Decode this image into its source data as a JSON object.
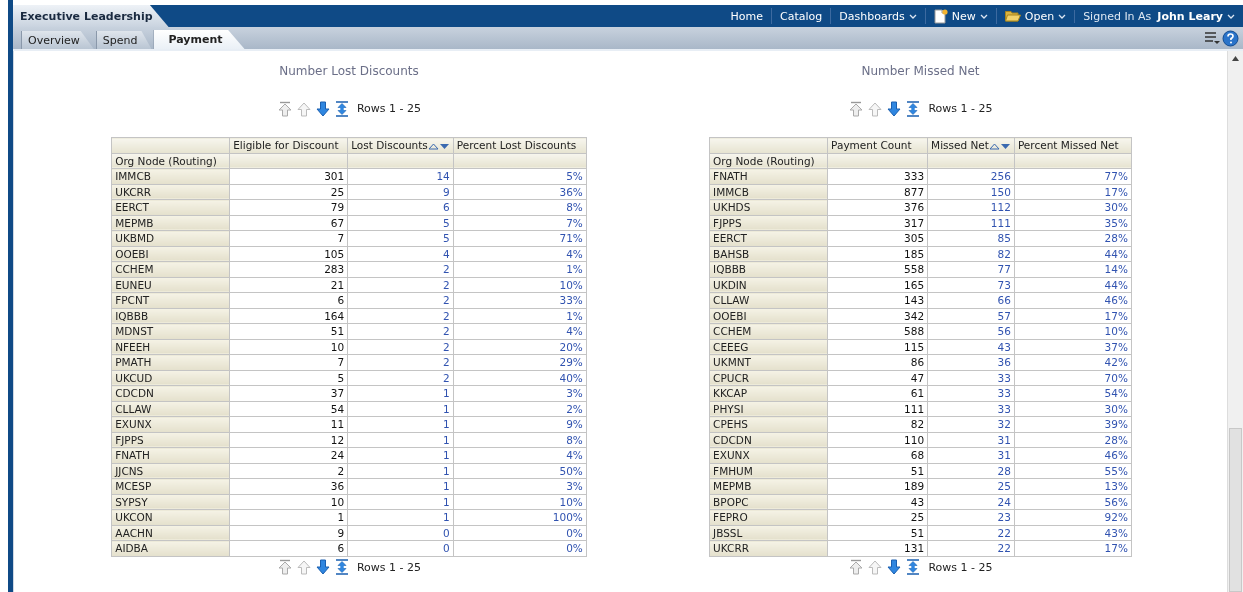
{
  "header": {
    "app_title": "Executive Leadership",
    "menu": [
      {
        "label": "Home",
        "kind": "link"
      },
      {
        "label": "Catalog",
        "kind": "link"
      },
      {
        "label": "Dashboards",
        "kind": "dropdown"
      },
      {
        "label": "New",
        "kind": "new"
      },
      {
        "label": "Open",
        "kind": "open"
      }
    ],
    "signed_in_label": "Signed In As",
    "user": "John Leary"
  },
  "tabs": [
    {
      "label": "Overview",
      "selected": false
    },
    {
      "label": "Spend",
      "selected": false
    },
    {
      "label": "Payment",
      "selected": true
    }
  ],
  "panels": [
    {
      "title": "Number Lost Discounts",
      "pager_top": "Rows 1 - 25",
      "pager_bottom": "Rows 1 - 25",
      "table": {
        "row_header": "Org Node (Routing)",
        "columns": [
          {
            "kind": "label"
          },
          {
            "kind": "number",
            "label": "Eligible for Discount",
            "sorted": false
          },
          {
            "kind": "link",
            "label": "Lost Discounts",
            "sorted": true
          },
          {
            "kind": "link",
            "label": "Percent Lost Discounts",
            "sorted": false
          }
        ],
        "rows": [
          [
            "IMMCB",
            "301",
            "14",
            "5%"
          ],
          [
            "UKCRR",
            "25",
            "9",
            "36%"
          ],
          [
            "EERCT",
            "79",
            "6",
            "8%"
          ],
          [
            "MEPMB",
            "67",
            "5",
            "7%"
          ],
          [
            "UKBMD",
            "7",
            "5",
            "71%"
          ],
          [
            "OOEBI",
            "105",
            "4",
            "4%"
          ],
          [
            "CCHEM",
            "283",
            "2",
            "1%"
          ],
          [
            "EUNEU",
            "21",
            "2",
            "10%"
          ],
          [
            "FPCNT",
            "6",
            "2",
            "33%"
          ],
          [
            "IQBBB",
            "164",
            "2",
            "1%"
          ],
          [
            "MDNST",
            "51",
            "2",
            "4%"
          ],
          [
            "NFEEH",
            "10",
            "2",
            "20%"
          ],
          [
            "PMATH",
            "7",
            "2",
            "29%"
          ],
          [
            "UKCUD",
            "5",
            "2",
            "40%"
          ],
          [
            "CDCDN",
            "37",
            "1",
            "3%"
          ],
          [
            "CLLAW",
            "54",
            "1",
            "2%"
          ],
          [
            "EXUNX",
            "11",
            "1",
            "9%"
          ],
          [
            "FJPPS",
            "12",
            "1",
            "8%"
          ],
          [
            "FNATH",
            "24",
            "1",
            "4%"
          ],
          [
            "JJCNS",
            "2",
            "1",
            "50%"
          ],
          [
            "MCESP",
            "36",
            "1",
            "3%"
          ],
          [
            "SYPSY",
            "10",
            "1",
            "10%"
          ],
          [
            "UKCON",
            "1",
            "1",
            "100%"
          ],
          [
            "AACHN",
            "9",
            "0",
            "0%"
          ],
          [
            "AIDBA",
            "6",
            "0",
            "0%"
          ]
        ]
      }
    },
    {
      "title": "Number Missed Net",
      "pager_top": "Rows 1 - 25",
      "pager_bottom": "Rows 1 - 25",
      "table": {
        "row_header": "Org Node (Routing)",
        "columns": [
          {
            "kind": "label"
          },
          {
            "kind": "number",
            "label": "Payment Count",
            "sorted": false
          },
          {
            "kind": "link",
            "label": "Missed Net",
            "sorted": true
          },
          {
            "kind": "link",
            "label": "Percent Missed Net",
            "sorted": false
          }
        ],
        "rows": [
          [
            "FNATH",
            "333",
            "256",
            "77%"
          ],
          [
            "IMMCB",
            "877",
            "150",
            "17%"
          ],
          [
            "UKHDS",
            "376",
            "112",
            "30%"
          ],
          [
            "FJPPS",
            "317",
            "111",
            "35%"
          ],
          [
            "EERCT",
            "305",
            "85",
            "28%"
          ],
          [
            "BAHSB",
            "185",
            "82",
            "44%"
          ],
          [
            "IQBBB",
            "558",
            "77",
            "14%"
          ],
          [
            "UKDIN",
            "165",
            "73",
            "44%"
          ],
          [
            "CLLAW",
            "143",
            "66",
            "46%"
          ],
          [
            "OOEBI",
            "342",
            "57",
            "17%"
          ],
          [
            "CCHEM",
            "588",
            "56",
            "10%"
          ],
          [
            "CEEEG",
            "115",
            "43",
            "37%"
          ],
          [
            "UKMNT",
            "86",
            "36",
            "42%"
          ],
          [
            "CPUCR",
            "47",
            "33",
            "70%"
          ],
          [
            "KKCAP",
            "61",
            "33",
            "54%"
          ],
          [
            "PHYSI",
            "111",
            "33",
            "30%"
          ],
          [
            "CPEHS",
            "82",
            "32",
            "39%"
          ],
          [
            "CDCDN",
            "110",
            "31",
            "28%"
          ],
          [
            "EXUNX",
            "68",
            "31",
            "46%"
          ],
          [
            "FMHUM",
            "51",
            "28",
            "55%"
          ],
          [
            "MEPMB",
            "189",
            "25",
            "13%"
          ],
          [
            "BPOPC",
            "43",
            "24",
            "56%"
          ],
          [
            "FEPRO",
            "25",
            "23",
            "92%"
          ],
          [
            "JBSSL",
            "51",
            "22",
            "43%"
          ],
          [
            "UKCRR",
            "131",
            "22",
            "17%"
          ]
        ]
      }
    }
  ]
}
